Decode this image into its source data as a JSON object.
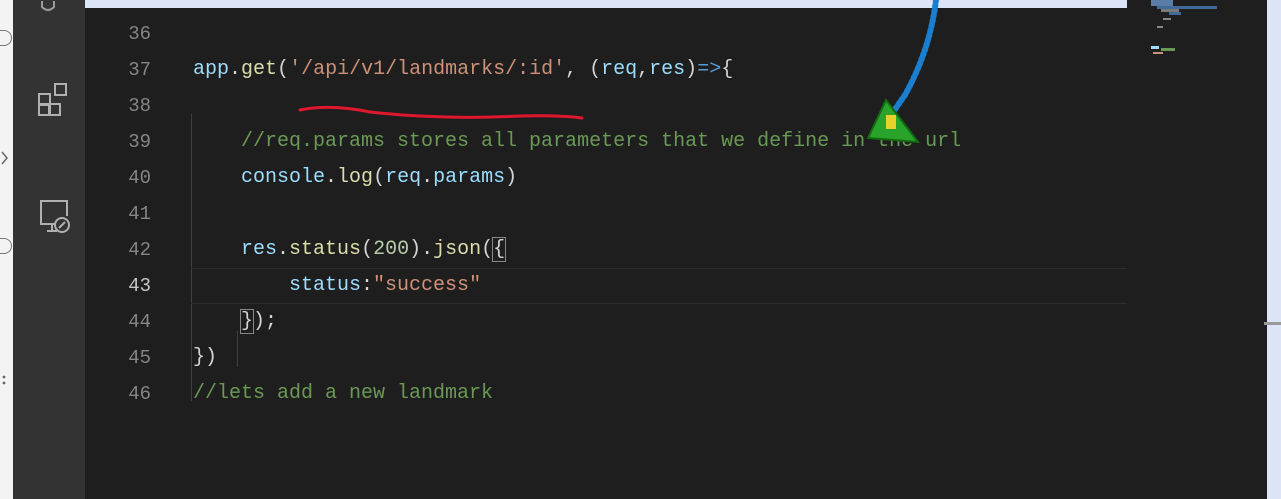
{
  "editor": {
    "lines": [
      {
        "number": "36",
        "tokens": []
      },
      {
        "number": "37",
        "tokens": [
          {
            "text": "app",
            "cls": "t-var"
          },
          {
            "text": ".",
            "cls": "t-punc"
          },
          {
            "text": "get",
            "cls": "t-fn"
          },
          {
            "text": "(",
            "cls": "t-punc"
          },
          {
            "text": "'/api/v1/landmarks/:id'",
            "cls": "t-str"
          },
          {
            "text": ", (",
            "cls": "t-punc"
          },
          {
            "text": "req",
            "cls": "t-var"
          },
          {
            "text": ",",
            "cls": "t-punc"
          },
          {
            "text": "res",
            "cls": "t-var"
          },
          {
            "text": ")",
            "cls": "t-punc"
          },
          {
            "text": "=>",
            "cls": "t-arrow"
          },
          {
            "text": "{",
            "cls": "t-punc"
          }
        ]
      },
      {
        "number": "38",
        "tokens": []
      },
      {
        "number": "39",
        "tokens": [
          {
            "text": "    //req.params stores all parameters that we define in the url",
            "cls": "t-com"
          }
        ]
      },
      {
        "number": "40",
        "tokens": [
          {
            "text": "    ",
            "cls": "t-punc"
          },
          {
            "text": "console",
            "cls": "t-var"
          },
          {
            "text": ".",
            "cls": "t-punc"
          },
          {
            "text": "log",
            "cls": "t-fn"
          },
          {
            "text": "(",
            "cls": "t-punc"
          },
          {
            "text": "req",
            "cls": "t-var"
          },
          {
            "text": ".",
            "cls": "t-punc"
          },
          {
            "text": "params",
            "cls": "t-var"
          },
          {
            "text": ")",
            "cls": "t-punc"
          }
        ]
      },
      {
        "number": "41",
        "tokens": []
      },
      {
        "number": "42",
        "tokens": [
          {
            "text": "    ",
            "cls": "t-punc"
          },
          {
            "text": "res",
            "cls": "t-var"
          },
          {
            "text": ".",
            "cls": "t-punc"
          },
          {
            "text": "status",
            "cls": "t-fn"
          },
          {
            "text": "(",
            "cls": "t-punc"
          },
          {
            "text": "200",
            "cls": "t-num"
          },
          {
            "text": ").",
            "cls": "t-punc"
          },
          {
            "text": "json",
            "cls": "t-fn"
          },
          {
            "text": "(",
            "cls": "t-punc"
          },
          {
            "text": "{",
            "cls": "t-punc bracket-box"
          }
        ]
      },
      {
        "number": "43",
        "current": true,
        "tokens": [
          {
            "text": "        ",
            "cls": "t-punc"
          },
          {
            "text": "status",
            "cls": "t-var"
          },
          {
            "text": ":",
            "cls": "t-punc"
          },
          {
            "text": "\"success\"",
            "cls": "t-str"
          }
        ]
      },
      {
        "number": "44",
        "tokens": [
          {
            "text": "    ",
            "cls": "t-punc"
          },
          {
            "text": "}",
            "cls": "t-punc bracket-box"
          },
          {
            "text": ");",
            "cls": "t-punc"
          }
        ]
      },
      {
        "number": "45",
        "tokens": [
          {
            "text": "})",
            "cls": "t-punc"
          }
        ]
      },
      {
        "number": "46",
        "tokens": [
          {
            "text": "//lets add a new landmark",
            "cls": "t-com"
          }
        ]
      }
    ]
  },
  "activity_bar": {
    "icons": [
      "extensions-icon",
      "remote-explorer-icon"
    ]
  },
  "colors": {
    "editor_bg": "#1e1e1e",
    "activity_bar_bg": "#333333",
    "annotation_underline": "#e0182d",
    "annotation_arrow": "#1a7fd0",
    "annotation_cursor": "#2aa32a"
  }
}
